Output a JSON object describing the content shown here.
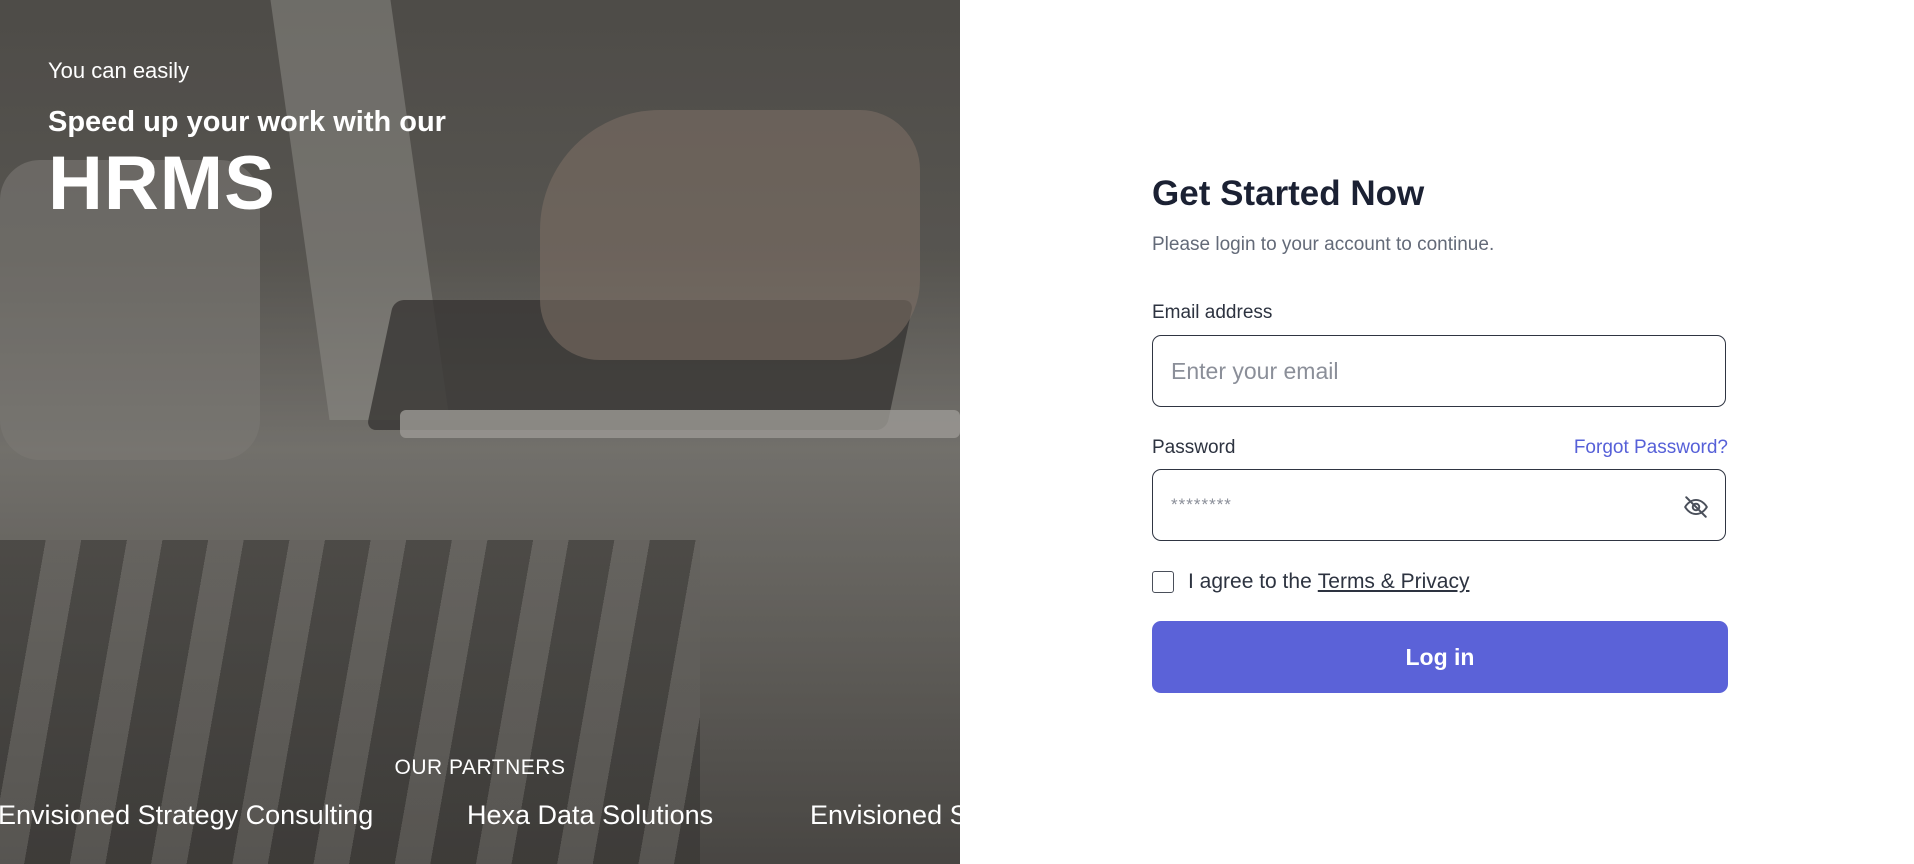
{
  "hero": {
    "eyebrow": "You can easily",
    "tagline": "Speed up your work with our",
    "brand": "HRMS",
    "partners_title": "OUR PARTNERS",
    "partners": [
      "Envisioned Strategy Consulting",
      "Hexa Data Solutions",
      "Envisioned Strategy Consulting"
    ]
  },
  "form": {
    "title": "Get Started Now",
    "subtitle": "Please login to your account to continue.",
    "email_label": "Email address",
    "email_placeholder": "Enter your email",
    "password_label": "Password",
    "forgot_label": "Forgot Password?",
    "password_placeholder": "********",
    "agree_text": "I agree to the",
    "terms_label": "Terms & Privacy",
    "login_label": "Log in",
    "eye_icon": "eye-off-icon"
  },
  "colors": {
    "accent": "#5b62d8",
    "link": "#5660d8",
    "title": "#1b2133"
  }
}
